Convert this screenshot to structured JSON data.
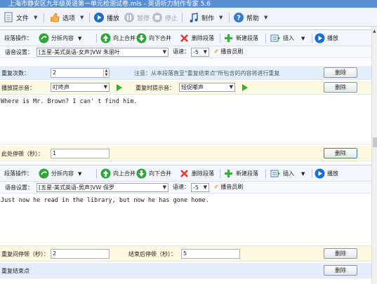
{
  "window": {
    "title": "上海市静安区九年级英语第一单元检测试卷.mls - 英语听力制作专家 5.6"
  },
  "menu": {
    "file": "文件",
    "options": "选项",
    "play": "播放",
    "pause": "暂停",
    "stop": "停止",
    "make": "制作",
    "help": "帮助"
  },
  "toolbar_labels": {
    "section_ops": "段落操作：",
    "split": "分拆内容",
    "merge_up": "向上合并",
    "merge_down": "向下合并",
    "delete_section": "删除段落",
    "new_section": "新建段落",
    "insert": "插入",
    "play": "播放",
    "voice_settings": "语音设置：",
    "speed": "语速：",
    "announcer": "播音员刷",
    "delete": "删除"
  },
  "section1": {
    "voice": "[五星-美式英语-女声]VW 朱丽叶",
    "speed": "-5",
    "repeat_label": "重复次数：",
    "repeat_value": "2",
    "repeat_note": "注意：从本段落直至\"重复结束点\"所包含的内容将进行重复",
    "prompt_label": "播放提示音：",
    "prompt_value": "叮咚声",
    "repeat_prompt_label": "重复时提示音：",
    "repeat_prompt_value": "短促嘟声",
    "text": "Where is Mr. Brown? I can' t find him.",
    "pause_label": "此处停顿（秒）：",
    "pause_value": "1"
  },
  "section2": {
    "voice": "[五星-美式英语-男声]VW 保罗",
    "speed": "-5",
    "text": "Just now he read in the library, but now he has gone home.",
    "repeat_pause_label": "重复间停顿（秒）：",
    "repeat_pause_value": "2",
    "end_pause_label": "结束后停顿（秒）：",
    "end_pause_value": "5",
    "repeat_end_label": "重复结束点"
  },
  "colors": {
    "repeat_row": "#e4eefb",
    "prompt_row": "#fdf9e0",
    "pause_row": "#fdf9e0",
    "play_green": "#2db32d",
    "accent_blue": "#1a6fc9"
  }
}
